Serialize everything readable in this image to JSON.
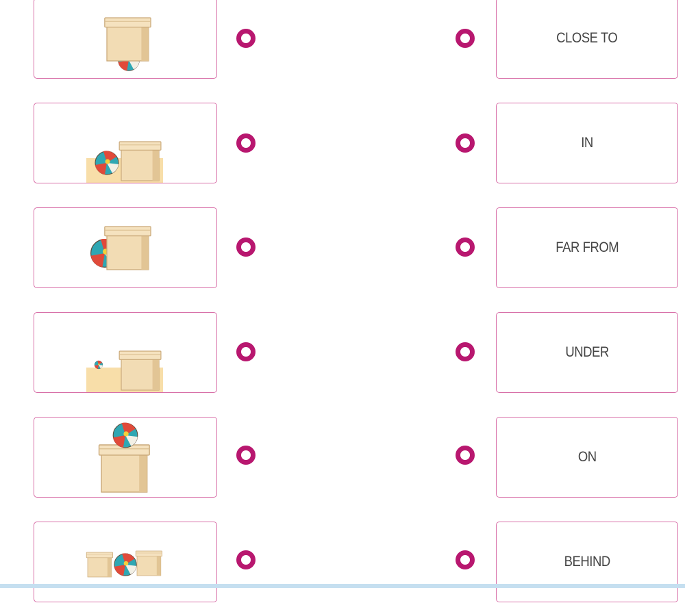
{
  "colors": {
    "accent": "#b8176f",
    "card_border": "#d86fa8",
    "box": "#f2dcb4",
    "floor": "#f8dea9"
  },
  "left_cards": [
    {
      "icon": "ball-under-box-image"
    },
    {
      "icon": "ball-close-to-box-image"
    },
    {
      "icon": "ball-behind-box-image"
    },
    {
      "icon": "ball-far-from-box-image"
    },
    {
      "icon": "ball-on-box-image"
    },
    {
      "icon": "ball-between-boxes-image"
    }
  ],
  "right_cards": [
    {
      "label": "CLOSE TO"
    },
    {
      "label": "IN"
    },
    {
      "label": "FAR FROM"
    },
    {
      "label": "UNDER"
    },
    {
      "label": "ON"
    },
    {
      "label": "BEHIND"
    }
  ]
}
